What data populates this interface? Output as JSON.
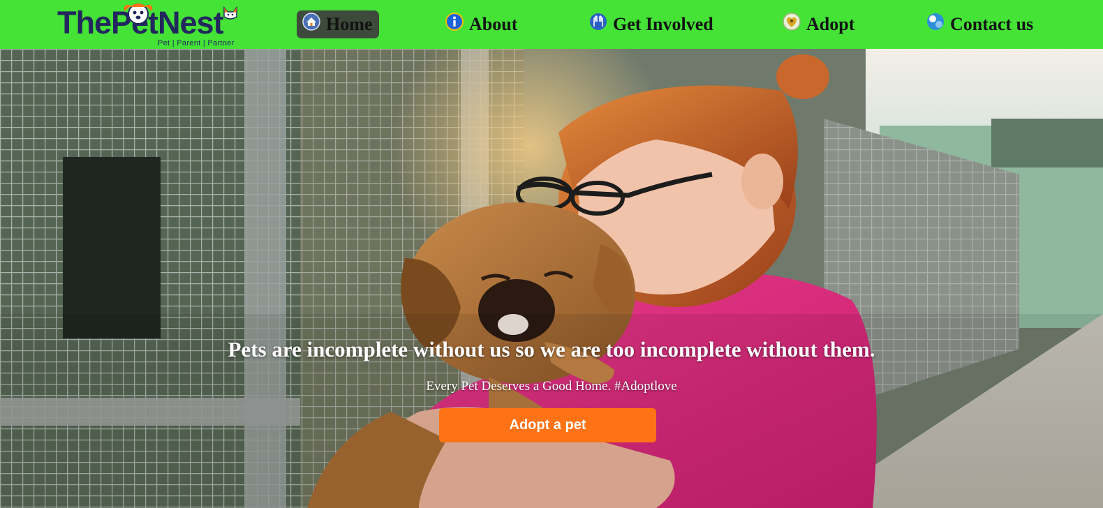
{
  "brand": {
    "logo_text": "ThePetNest",
    "tagline": "Pet | Parent | Partner",
    "colors": {
      "nav_bg": "#44e336",
      "logo": "#22275d",
      "active_tab": "#3e4a3b",
      "cta": "#ff7316"
    }
  },
  "nav": {
    "items": [
      {
        "label": "Home",
        "icon": "home-icon",
        "active": true
      },
      {
        "label": "About",
        "icon": "info-icon",
        "active": false
      },
      {
        "label": "Get Involved",
        "icon": "hands-icon",
        "active": false
      },
      {
        "label": "Adopt",
        "icon": "paw-heart-icon",
        "active": false
      },
      {
        "label": "Contact us",
        "icon": "contact-icon",
        "active": false
      }
    ]
  },
  "hero": {
    "image": "woman-hugging-puppy-photo",
    "quote": "Pets are incomplete without us so we are too incomplete without them.",
    "subquote": "Every Pet Deserves a Good Home. #Adoptlove",
    "cta_label": "Adopt a pet"
  }
}
